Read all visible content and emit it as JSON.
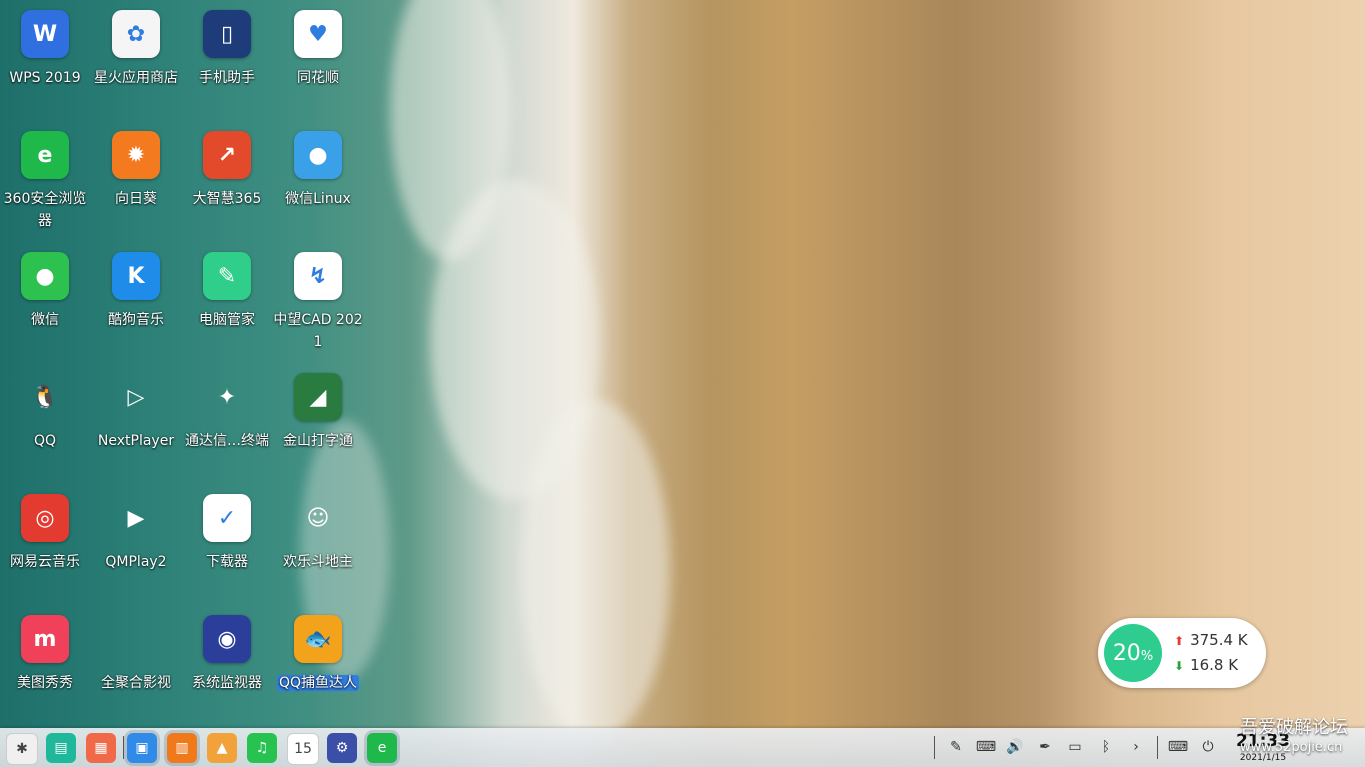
{
  "desktop": {
    "icons": [
      {
        "label": "WPS 2019",
        "icon": "wps-icon",
        "color": "#2f6fe0",
        "glyph": "W"
      },
      {
        "label": "星火应用商店",
        "icon": "spark-store-icon",
        "color": "#f5f5f5",
        "glyph": "✿"
      },
      {
        "label": "手机助手",
        "icon": "phone-assistant-icon",
        "color": "#1f3c7a",
        "glyph": "▯"
      },
      {
        "label": "同花顺",
        "icon": "tonghuashun-icon",
        "color": "#ffffff",
        "glyph": "♥"
      },
      {
        "label": "360安全浏览器",
        "icon": "360-browser-icon",
        "color": "#1fb84a",
        "glyph": "e"
      },
      {
        "label": "向日葵",
        "icon": "sunflower-icon",
        "color": "#f47a1f",
        "glyph": "✹"
      },
      {
        "label": "大智慧365",
        "icon": "dazhihui-icon",
        "color": "#e24a2b",
        "glyph": "↗"
      },
      {
        "label": "微信Linux",
        "icon": "wechat-linux-icon",
        "color": "#3aa0e8",
        "glyph": "●"
      },
      {
        "label": "微信",
        "icon": "wechat-icon",
        "color": "#2dc14f",
        "glyph": "●"
      },
      {
        "label": "酷狗音乐",
        "icon": "kugou-music-icon",
        "color": "#1e8ce8",
        "glyph": "K"
      },
      {
        "label": "电脑管家",
        "icon": "pc-manager-icon",
        "color": "#2fce8a",
        "glyph": "✎"
      },
      {
        "label": "中望CAD 2021",
        "icon": "zwcad-icon",
        "color": "#ffffff",
        "glyph": "↯"
      },
      {
        "label": "QQ",
        "icon": "qq-icon",
        "color": "transparent",
        "glyph": "🐧"
      },
      {
        "label": "NextPlayer",
        "icon": "nextplayer-icon",
        "color": "transparent",
        "glyph": "▷"
      },
      {
        "label": "通达信…终端",
        "icon": "tongdaxin-icon",
        "color": "transparent",
        "glyph": "✦"
      },
      {
        "label": "金山打字通",
        "icon": "kingsoft-typing-icon",
        "color": "#2a7b3f",
        "glyph": "◢"
      },
      {
        "label": "网易云音乐",
        "icon": "netease-music-icon",
        "color": "#e33b30",
        "glyph": "◎"
      },
      {
        "label": "QMPlay2",
        "icon": "qmplay2-icon",
        "color": "transparent",
        "glyph": "▶"
      },
      {
        "label": "下载器",
        "icon": "downloader-icon",
        "color": "#ffffff",
        "glyph": "✓"
      },
      {
        "label": "欢乐斗地主",
        "icon": "doudizhu-icon",
        "color": "transparent",
        "glyph": "☺"
      },
      {
        "label": "美图秀秀",
        "icon": "meitu-icon",
        "color": "#f1415a",
        "glyph": "m"
      },
      {
        "label": "全聚合影视",
        "icon": "quanjuhe-icon",
        "color": "transparent",
        "glyph": ""
      },
      {
        "label": "系统监视器",
        "icon": "system-monitor-icon",
        "color": "#2b3f9a",
        "glyph": "◉"
      },
      {
        "label": "QQ捕鱼达人",
        "icon": "qq-fishing-icon",
        "color": "#f2a21b",
        "glyph": "🐟",
        "selected": true
      }
    ]
  },
  "netspeed": {
    "cpu": "20",
    "unit": "%",
    "upload": "375.4 K",
    "download": "16.8 K"
  },
  "taskbar": {
    "apps": [
      {
        "icon": "launcher-icon",
        "color": "#f0f0f0",
        "glyph": "✱",
        "name": "launcher"
      },
      {
        "icon": "multitask-view-icon",
        "color": "#1fb89a",
        "glyph": "▤",
        "name": "multitask"
      },
      {
        "icon": "show-desktop-icon",
        "color": "#f06a4a",
        "glyph": "▦",
        "name": "desktop"
      },
      {
        "icon": "file-manager-icon",
        "color": "#2f8ae8",
        "glyph": "▣",
        "name": "file-manager",
        "active": true
      },
      {
        "icon": "app-store-icon",
        "color": "#f07a1a",
        "glyph": "▥",
        "name": "app-store",
        "active": true
      },
      {
        "icon": "image-viewer-icon",
        "color": "#f2a23a",
        "glyph": "▲",
        "name": "image-viewer"
      },
      {
        "icon": "music-icon",
        "color": "#27c24f",
        "glyph": "♫",
        "name": "music"
      },
      {
        "icon": "calendar-icon",
        "color": "#ffffff",
        "glyph": "15",
        "name": "calendar"
      },
      {
        "icon": "settings-icon",
        "color": "#3c4fa8",
        "glyph": "⚙",
        "name": "settings"
      },
      {
        "icon": "360-browser-taskbar-icon",
        "color": "#1fb84a",
        "glyph": "e",
        "name": "browser",
        "active": true
      }
    ],
    "tray": [
      {
        "icon": "screenshot-tool-icon",
        "glyph": "✎"
      },
      {
        "icon": "keyboard-icon",
        "glyph": "⌨"
      },
      {
        "icon": "volume-icon",
        "glyph": "🔊"
      },
      {
        "icon": "pen-icon",
        "glyph": "✒"
      },
      {
        "icon": "battery-icon",
        "glyph": "▭"
      },
      {
        "icon": "bluetooth-icon",
        "glyph": "ᛒ"
      },
      {
        "icon": "chevron-right-icon",
        "glyph": "›"
      },
      {
        "icon": "onscreen-keyboard-icon",
        "glyph": "⌨"
      },
      {
        "icon": "power-icon",
        "glyph": "⏻"
      }
    ],
    "clock": {
      "time": "21:33",
      "date": "2021/1/15"
    }
  },
  "watermark": {
    "title": "吾爱破解论坛",
    "url": "www.52pojie.cn"
  }
}
